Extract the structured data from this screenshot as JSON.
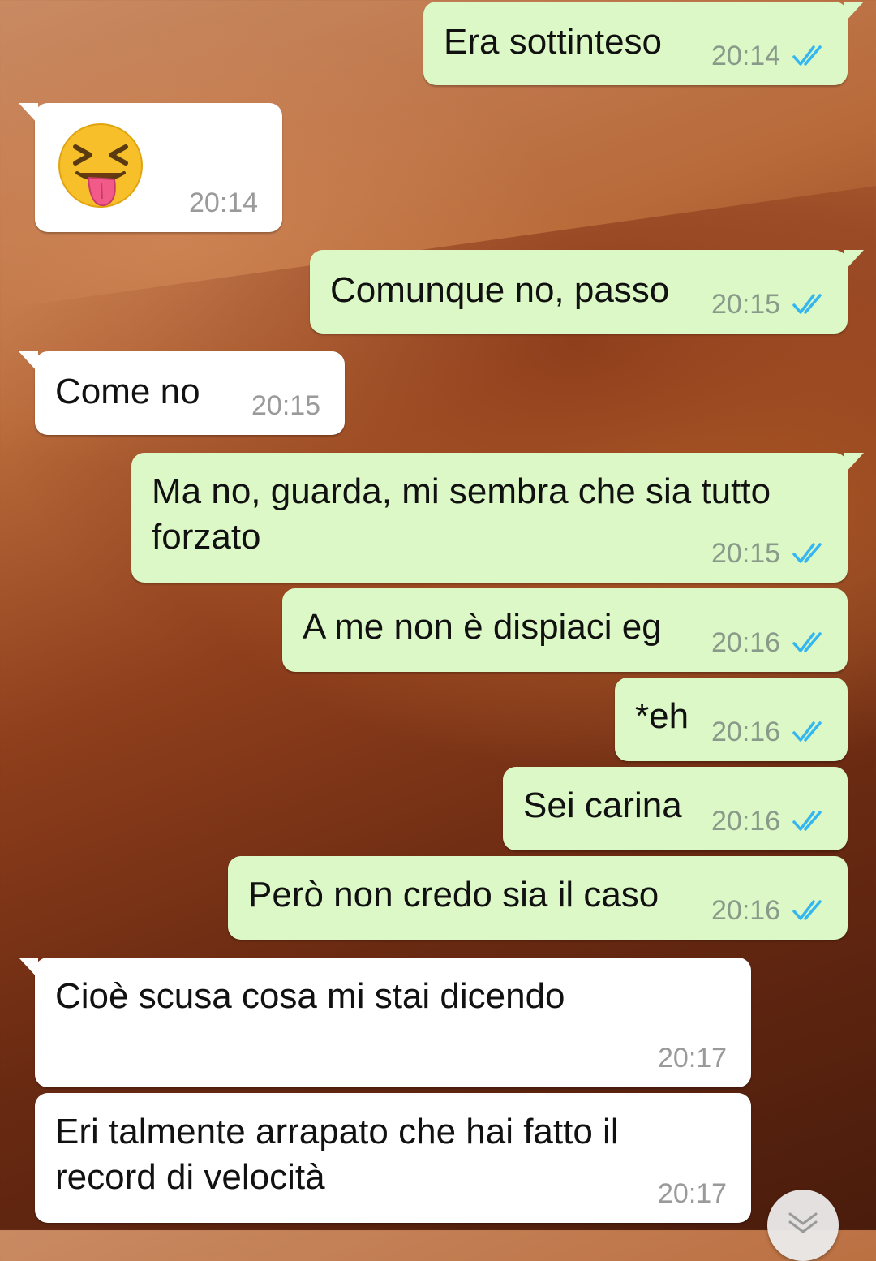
{
  "chat": {
    "wallpaper": "desert-dunes",
    "colors": {
      "outgoing_bubble": "#dcf8c6",
      "incoming_bubble": "#ffffff",
      "read_ticks": "#34b7f1",
      "timestamp": "#8a9a8a"
    },
    "messages": [
      {
        "direction": "out",
        "text": "Era sottinteso",
        "time": "20:14",
        "status": "read"
      },
      {
        "direction": "in",
        "emoji": "squinting-face-with-tongue",
        "time": "20:14"
      },
      {
        "direction": "out",
        "text": "Comunque no, passo",
        "time": "20:15",
        "status": "read"
      },
      {
        "direction": "in",
        "text": "Come no",
        "time": "20:15"
      },
      {
        "direction": "out",
        "text_lines": [
          "Ma no, guarda, mi sembra che sia tutto",
          "forzato"
        ],
        "time": "20:15",
        "status": "read"
      },
      {
        "direction": "out",
        "text": "A me non è dispiaci eg",
        "time": "20:16",
        "status": "read"
      },
      {
        "direction": "out",
        "text": "*eh",
        "time": "20:16",
        "status": "read"
      },
      {
        "direction": "out",
        "text": "Sei carina",
        "time": "20:16",
        "status": "read"
      },
      {
        "direction": "out",
        "text": "Però non credo sia il caso",
        "time": "20:16",
        "status": "read"
      },
      {
        "direction": "in",
        "text": "Cioè scusa cosa mi stai dicendo",
        "time": "20:17"
      },
      {
        "direction": "in",
        "text_lines": [
          "Eri talmente arrapato che hai fatto il",
          "record di velocità"
        ],
        "time": "20:17"
      }
    ],
    "scroll_button_icon": "chevron-double-down-icon"
  }
}
